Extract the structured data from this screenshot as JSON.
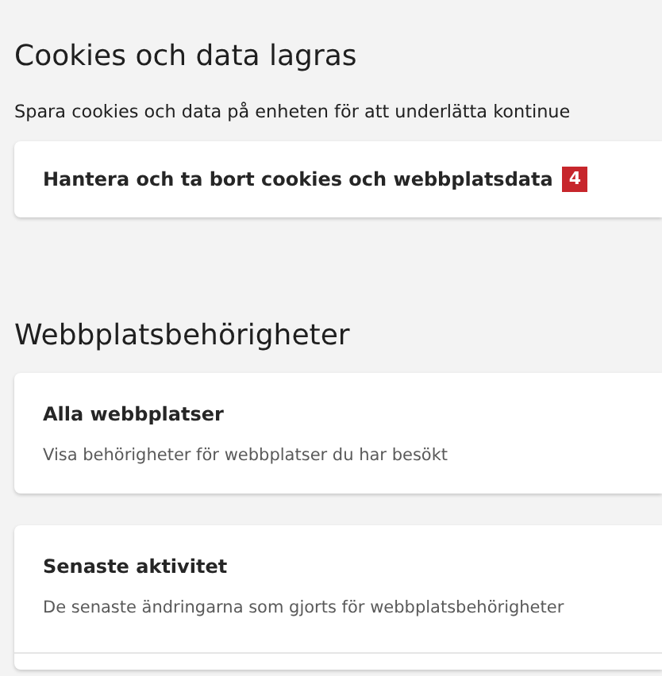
{
  "sections": [
    {
      "title": "Cookies och data lagras",
      "description": "Spara cookies och data på enheten för att underlätta kontinue",
      "cards": [
        {
          "title": "Hantera och ta bort cookies och webbplatsdata",
          "badge": "4"
        }
      ]
    },
    {
      "title": "Webbplatsbehörigheter",
      "cards": [
        {
          "title": "Alla webbplatser",
          "subtitle": "Visa behörigheter för webbplatser du har besökt"
        },
        {
          "title": "Senaste aktivitet",
          "subtitle": "De senaste ändringarna som gjorts för webbplatsbehörigheter",
          "divider": true
        }
      ]
    }
  ]
}
